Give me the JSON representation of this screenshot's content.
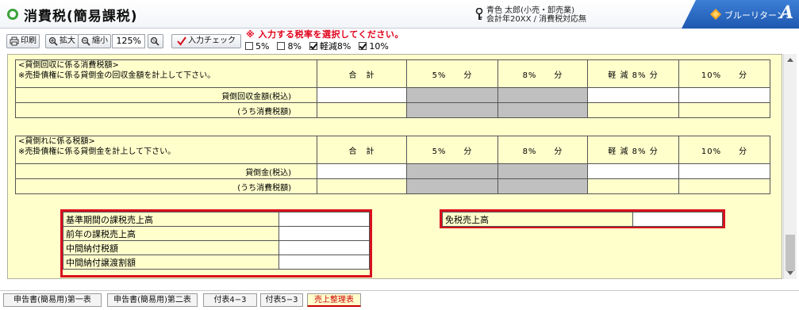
{
  "header": {
    "title": "消費税(簡易課税)",
    "user_line1": "青色 太郎(小売・卸売業)",
    "user_line2": "会計年20XX / 消費税対応無",
    "brand": "ブルーリターン",
    "brand_a": "A"
  },
  "toolbar": {
    "print": "印刷",
    "zoom_in": "拡大",
    "zoom_out": "縮小",
    "zoom_value": "125%",
    "check": "入力チェック",
    "notice": "※ 入力する税率を選択してください。",
    "rates": [
      {
        "label": "5%",
        "checked": false
      },
      {
        "label": "8%",
        "checked": false
      },
      {
        "label": "軽減8%",
        "checked": true
      },
      {
        "label": "10%",
        "checked": true
      }
    ]
  },
  "table1": {
    "desc1": "<貸倒回収に係る消費税額>",
    "desc2": "※売掛債権に係る貸倒金の回収金額を計上して下さい。",
    "headers": [
      "合　計",
      "5%　　分",
      "8%　　分",
      "軽 減 8% 分",
      "10%　　分"
    ],
    "row1": "貸倒回収金額(税込)",
    "row2": "(うち消費税額)"
  },
  "table2": {
    "desc1": "<貸倒れに係る税額>",
    "desc2": "※売掛債権に係る貸倒金を計上して下さい。",
    "headers": [
      "合　計",
      "5%　　分",
      "8%　　分",
      "軽 減 8% 分",
      "10%　　分"
    ],
    "row1": "貸倒金(税込)",
    "row2": "(うち消費税額)"
  },
  "box_left": {
    "rows": [
      "基準期間の課税売上高",
      "前年の課税売上高",
      "中間納付税額",
      "中間納付譲渡割額"
    ]
  },
  "box_right": {
    "row": "免税売上高"
  },
  "tabs": [
    "申告書(簡易用)第一表",
    "申告書(簡易用)第二表",
    "付表4−3",
    "付表5−3",
    "売上整理表"
  ],
  "colors": {
    "accent_red": "#d8101c",
    "sheet_bg": "#ffffcc",
    "brand_blue": "#2a66c0"
  }
}
